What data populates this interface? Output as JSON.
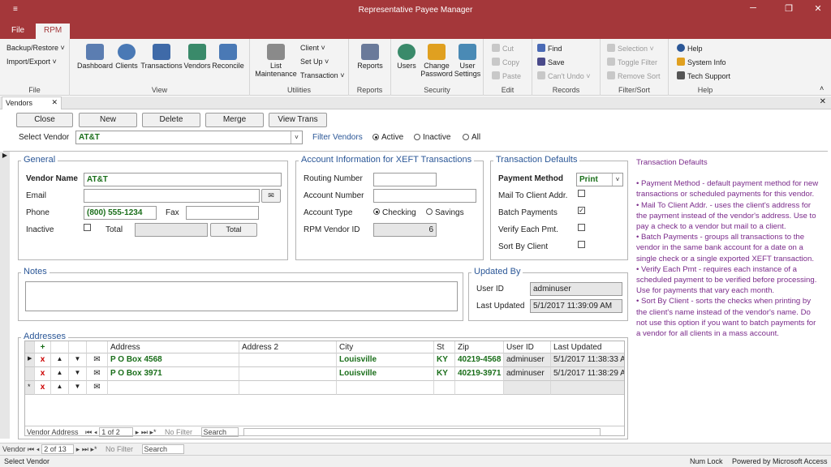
{
  "window": {
    "title": "Representative Payee Manager",
    "qat": "≡"
  },
  "ribbon_tabs": [
    "File",
    "RPM"
  ],
  "ribbon": {
    "file": {
      "backup": "Backup/Restore ˅",
      "import": "Import/Export ˅",
      "label": "File"
    },
    "view": {
      "items": [
        "Dashboard",
        "Clients",
        "Transactions",
        "Vendors",
        "Reconcile"
      ],
      "label": "View"
    },
    "utilities": {
      "list1": "List",
      "list2": "Maintenance",
      "client": "Client ˅",
      "setup": "Set Up ˅",
      "transaction": "Transaction ˅",
      "label": "Utilities"
    },
    "reports": {
      "item": "Reports",
      "label": "Reports"
    },
    "security": {
      "users": "Users",
      "change1": "Change",
      "change2": "Password",
      "user1": "User",
      "user2": "Settings",
      "label": "Security"
    },
    "edit": {
      "cut": "Cut",
      "copy": "Copy",
      "paste": "Paste",
      "label": "Edit"
    },
    "records": {
      "find": "Find",
      "save": "Save",
      "undo": "Can't Undo ˅",
      "label": "Records"
    },
    "filtersort": {
      "selection": "Selection ˅",
      "toggle": "Toggle Filter",
      "remove": "Remove Sort",
      "label": "Filter/Sort"
    },
    "help": {
      "help": "Help",
      "sysinfo": "System Info",
      "tech": "Tech Support",
      "label": "Help"
    }
  },
  "doc_tab": {
    "label": "Vendors"
  },
  "toolbar": {
    "close": "Close",
    "new": "New",
    "delete": "Delete",
    "merge": "Merge",
    "view_trans": "View Trans"
  },
  "select_vendor": {
    "label": "Select Vendor",
    "value": "AT&T"
  },
  "filter": {
    "label": "Filter Vendors",
    "active": "Active",
    "inactive": "Inactive",
    "all": "All"
  },
  "general": {
    "title": "General",
    "vendor_name_label": "Vendor Name",
    "vendor_name": "AT&T",
    "email_label": "Email",
    "email": "",
    "phone_label": "Phone",
    "phone": "(800) 555-1234",
    "fax_label": "Fax",
    "fax": "",
    "inactive_label": "Inactive",
    "total_label": "Total",
    "total_button": "Total"
  },
  "account": {
    "title": "Account Information for XEFT Transactions",
    "routing_label": "Routing Number",
    "account_label": "Account Number",
    "type_label": "Account Type",
    "checking": "Checking",
    "savings": "Savings",
    "rpm_id_label": "RPM Vendor ID",
    "rpm_id": "6"
  },
  "defaults": {
    "title": "Transaction Defaults",
    "payment_method_label": "Payment Method",
    "payment_method": "Print",
    "mail_label": "Mail To Client Addr.",
    "batch_label": "Batch Payments",
    "verify_label": "Verify Each Pmt.",
    "sort_label": "Sort By Client",
    "batch_checked": "✓"
  },
  "notes": {
    "title": "Notes"
  },
  "updated": {
    "title": "Updated By",
    "user_id_label": "User ID",
    "user_id": "adminuser",
    "last_label": "Last Updated",
    "last": "5/1/2017 11:39:09 AM"
  },
  "help_text": {
    "title": "Transaction Defaults",
    "p1": "• Payment Method - default payment method for new transactions or scheduled payments for this vendor.",
    "p2": "• Mail To Client Addr. - uses the client's address for the payment instead of the vendor's address. Use to pay a check to a vendor but mail to a client.",
    "p3": "• Batch Payments - groups all transactions to the vendor in the same bank account for a date on a single check or a single exported XEFT transaction.",
    "p4": "• Verify Each Pmt - requires each instance of a scheduled payment to be verified before processing. Use for payments that vary each month.",
    "p5": "• Sort By Client - sorts the checks when printing by the client's name instead of the vendor's name. Do not use this option if you want to batch payments for a vendor for all clients in a mass account."
  },
  "addresses": {
    "title": "Addresses",
    "headers": {
      "add": "+",
      "address": "Address",
      "address2": "Address 2",
      "city": "City",
      "st": "St",
      "zip": "Zip",
      "user": "User ID",
      "updated": "Last Updated"
    },
    "rows": [
      {
        "address": "P O Box 4568",
        "address2": "",
        "city": "Louisville",
        "st": "KY",
        "zip": "40219-4568",
        "user": "adminuser",
        "updated": "5/1/2017 11:38:33 A"
      },
      {
        "address": "P O Box 3971",
        "address2": "",
        "city": "Louisville",
        "st": "KY",
        "zip": "40219-3971",
        "user": "adminuser",
        "updated": "5/1/2017 11:38:29 A"
      }
    ],
    "x": "x",
    "nav": {
      "label": "Vendor Address",
      "pos": "1 of 2",
      "filter": "No Filter",
      "search": "Search"
    }
  },
  "record_nav": {
    "label": "Vendor",
    "pos": "2 of 13",
    "filter": "No Filter",
    "search": "Search"
  },
  "status": {
    "left": "Select Vendor",
    "numlock": "Num Lock",
    "powered": "Powered by Microsoft Access"
  }
}
